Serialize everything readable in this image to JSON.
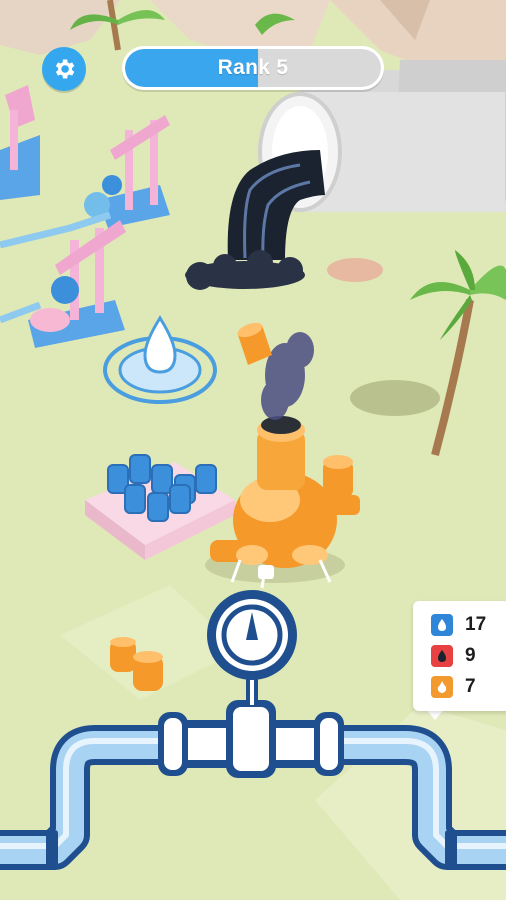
{
  "hud": {
    "rank_label": "Rank 5",
    "rank_progress": 0.52,
    "settings_icon": "gear-icon"
  },
  "inventory": {
    "items": [
      {
        "icon": "water-barrel-icon",
        "count": "17",
        "color": "#2f86d8"
      },
      {
        "icon": "oil-barrel-icon",
        "count": "9",
        "color": "#e84141"
      },
      {
        "icon": "fire-barrel-icon",
        "count": "7",
        "color": "#f29a2e"
      }
    ]
  },
  "colors": {
    "ground": "#dfe8b7",
    "accent_blue": "#35a7ee",
    "pipe_outline": "#1f4f8f",
    "pipe_fill": "#a9d3f3",
    "refinery_orange": "#f59a2a",
    "oil_black": "#1b2330"
  }
}
